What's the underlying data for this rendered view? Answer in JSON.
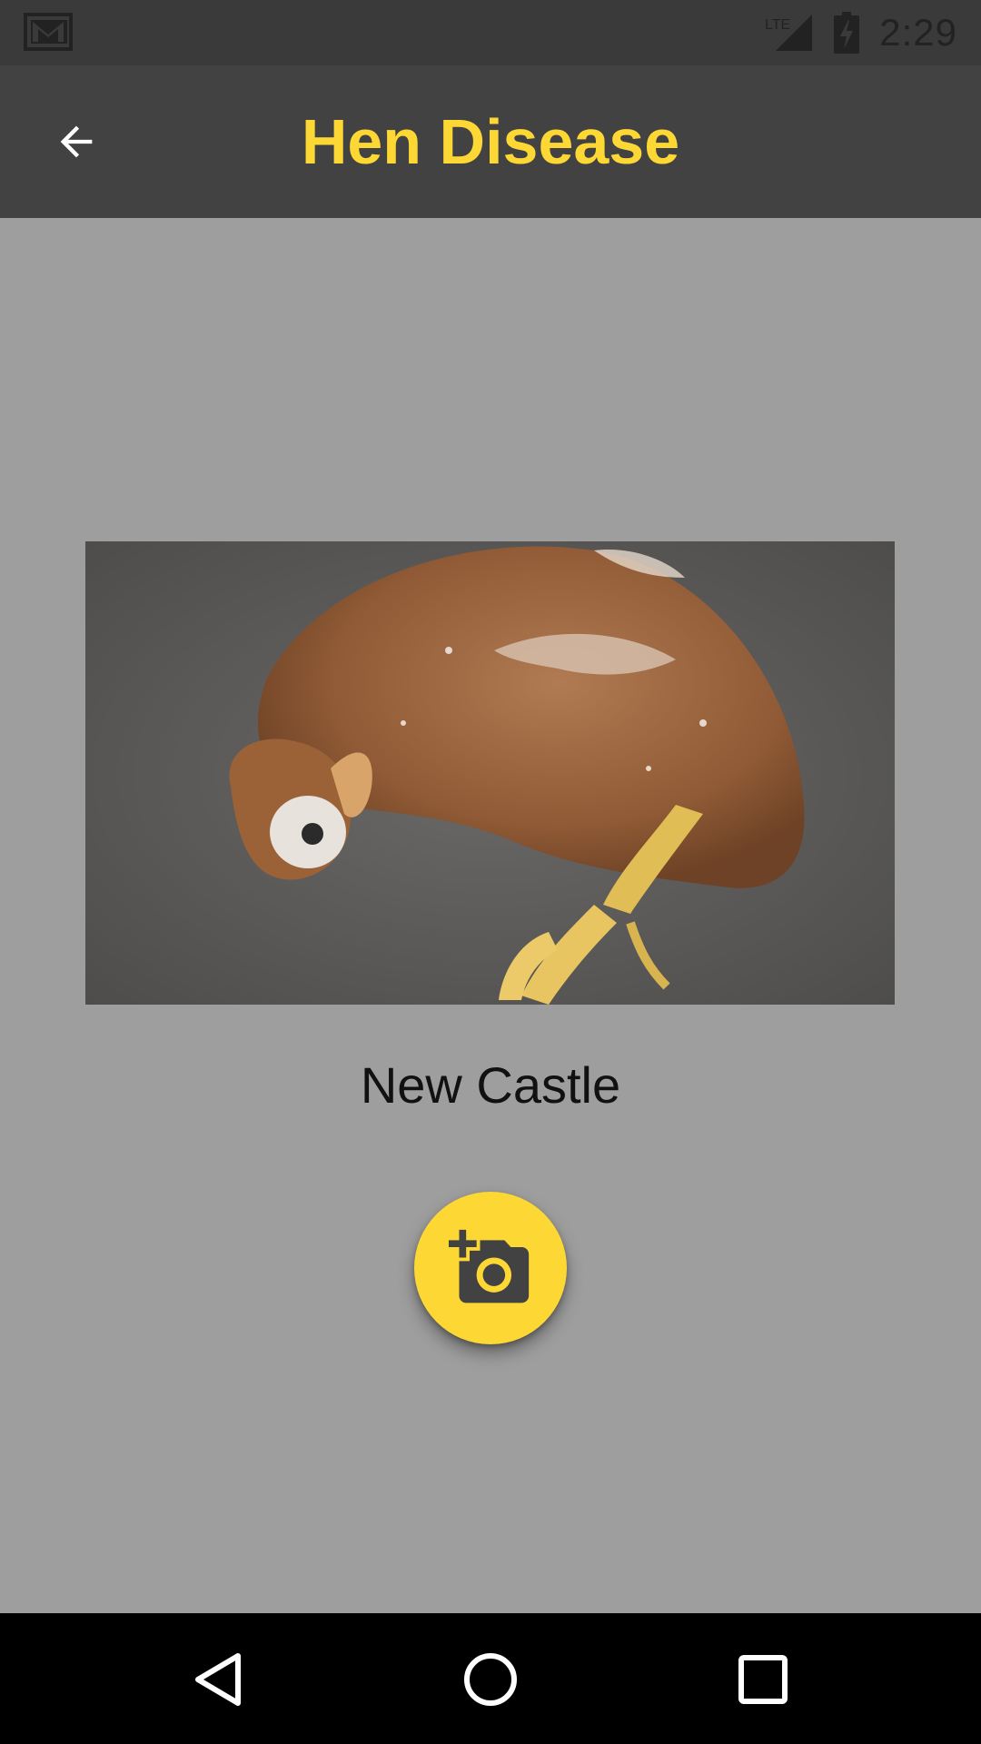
{
  "status_bar": {
    "time": "2:29",
    "network_label": "LTE",
    "icons": [
      "gmail-notification-icon",
      "lte-signal-icon",
      "battery-charging-icon"
    ]
  },
  "app_bar": {
    "title": "Hen Disease",
    "back_icon": "arrow-back-icon"
  },
  "disease": {
    "name": "New Castle"
  },
  "fab": {
    "icon": "add-a-photo-icon"
  },
  "nav_bar": {
    "icons": [
      "nav-back-icon",
      "nav-home-icon",
      "nav-recents-icon"
    ]
  },
  "colors": {
    "accent": "#fdd835",
    "app_bar": "#424242",
    "status_bar": "#3a3a3a",
    "background": "#9e9e9e",
    "nav_bar": "#000000"
  }
}
